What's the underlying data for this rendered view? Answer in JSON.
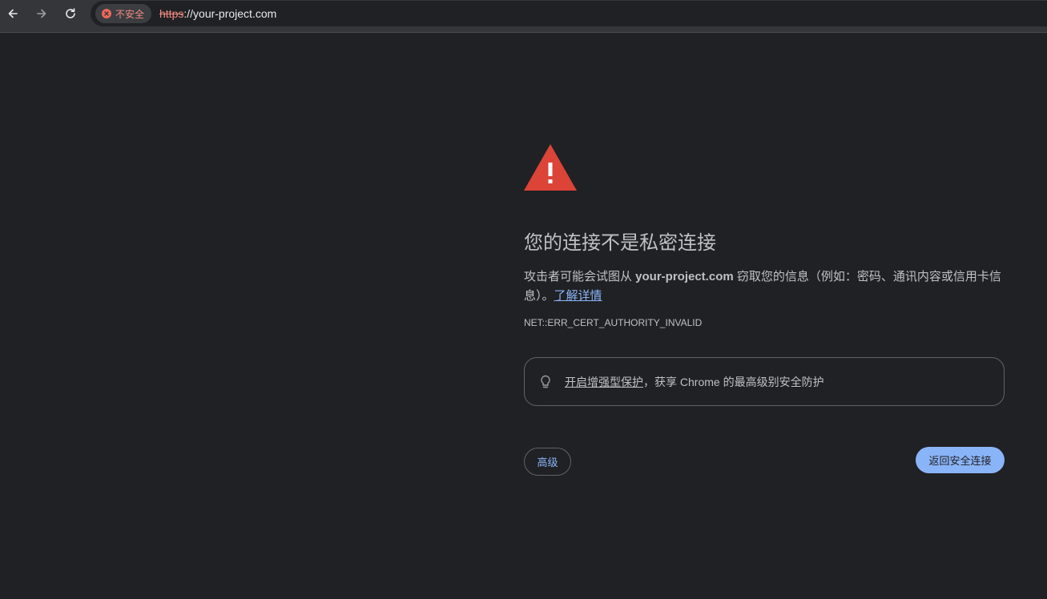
{
  "browser": {
    "security_chip": {
      "label": "不安全",
      "color": "#f28b82"
    },
    "url": {
      "scheme": "https",
      "rest": "://your-project.com"
    },
    "nav_icons": [
      "back-icon",
      "forward-icon",
      "reload-icon"
    ]
  },
  "interstitial": {
    "icon": "warning-triangle-icon",
    "accent": "#db4437",
    "title": "您的连接不是私密连接",
    "desc_prefix": "攻击者可能会试图从 ",
    "desc_domain": "your-project.com",
    "desc_suffix": " 窃取您的信息（例如：密码、通讯内容或信用卡信息）。",
    "learn_more": "了解详情",
    "error_code": "NET::ERR_CERT_AUTHORITY_INVALID",
    "enhanced": {
      "icon": "lightbulb-icon",
      "link": "开启增强型保护",
      "text": "，获享 Chrome 的最高级别安全防护"
    },
    "advanced_label": "高级",
    "back_label": "返回安全连接"
  }
}
